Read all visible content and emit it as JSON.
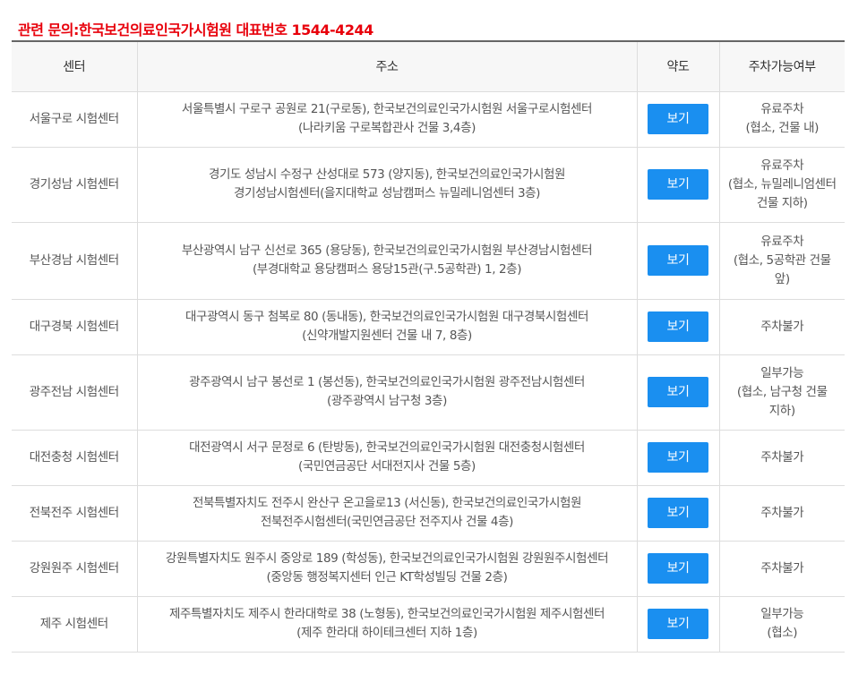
{
  "notice": "관련 문의:한국보건의료인국가시험원 대표번호 1544-4244",
  "headers": [
    "센터",
    "주소",
    "약도",
    "주차가능여부"
  ],
  "rows": [
    {
      "center": "서울구로 시험센터",
      "address": [
        "서울특별시 구로구 공원로 21(구로동), 한국보건의료인국가시험원 서울구로시험센터",
        "(나라키움 구로복합관사 건물 3,4층)"
      ],
      "map_label": "보기",
      "parking": [
        "유료주차",
        "(협소, 건물 내)"
      ]
    },
    {
      "center": "경기성남 시험센터",
      "address": [
        "경기도 성남시 수정구 산성대로 573 (양지동), 한국보건의료인국가시험원",
        "경기성남시험센터(을지대학교 성남캠퍼스 뉴밀레니엄센터 3층)"
      ],
      "map_label": "보기",
      "parking": [
        "유료주차",
        "(협소, 뉴밀레니엄센터",
        "건물 지하)"
      ]
    },
    {
      "center": "부산경남 시험센터",
      "address": [
        "부산광역시 남구 신선로 365 (용당동), 한국보건의료인국가시험원 부산경남시험센터",
        "(부경대학교 용당캠퍼스 용당15관(구.5공학관) 1, 2층)"
      ],
      "map_label": "보기",
      "parking": [
        "유료주차",
        "(협소, 5공학관 건물",
        "앞)"
      ]
    },
    {
      "center": "대구경북 시험센터",
      "address": [
        "대구광역시 동구 첨복로 80 (동내동), 한국보건의료인국가시험원 대구경북시험센터",
        "(신약개발지원센터 건물 내 7, 8층)"
      ],
      "map_label": "보기",
      "parking": [
        "주차불가"
      ]
    },
    {
      "center": "광주전남 시험센터",
      "address": [
        "광주광역시 남구 봉선로 1 (봉선동), 한국보건의료인국가시험원 광주전남시험센터",
        "(광주광역시 남구청 3층)"
      ],
      "map_label": "보기",
      "parking": [
        "일부가능",
        "(협소, 남구청 건물",
        "지하)"
      ]
    },
    {
      "center": "대전충청 시험센터",
      "address": [
        "대전광역시 서구 문정로 6 (탄방동), 한국보건의료인국가시험원 대전충청시험센터",
        "(국민연금공단 서대전지사 건물 5층)"
      ],
      "map_label": "보기",
      "parking": [
        "주차불가"
      ]
    },
    {
      "center": "전북전주 시험센터",
      "address": [
        "전북특별자치도 전주시 완산구 온고을로13 (서신동), 한국보건의료인국가시험원",
        "전북전주시험센터(국민연금공단 전주지사 건물 4층)"
      ],
      "map_label": "보기",
      "parking": [
        "주차불가"
      ]
    },
    {
      "center": "강원원주 시험센터",
      "address": [
        "강원특별자치도 원주시 중앙로 189 (학성동), 한국보건의료인국가시험원 강원원주시험센터",
        "(중앙동 행정복지센터 인근 KT학성빌딩 건물 2층)"
      ],
      "map_label": "보기",
      "parking": [
        "주차불가"
      ]
    },
    {
      "center": "제주 시험센터",
      "address": [
        "제주특별자치도 제주시 한라대학로 38 (노형동), 한국보건의료인국가시험원 제주시험센터",
        "(제주 한라대 하이테크센터 지하 1층)"
      ],
      "map_label": "보기",
      "parking": [
        "일부가능",
        "(협소)"
      ]
    }
  ]
}
